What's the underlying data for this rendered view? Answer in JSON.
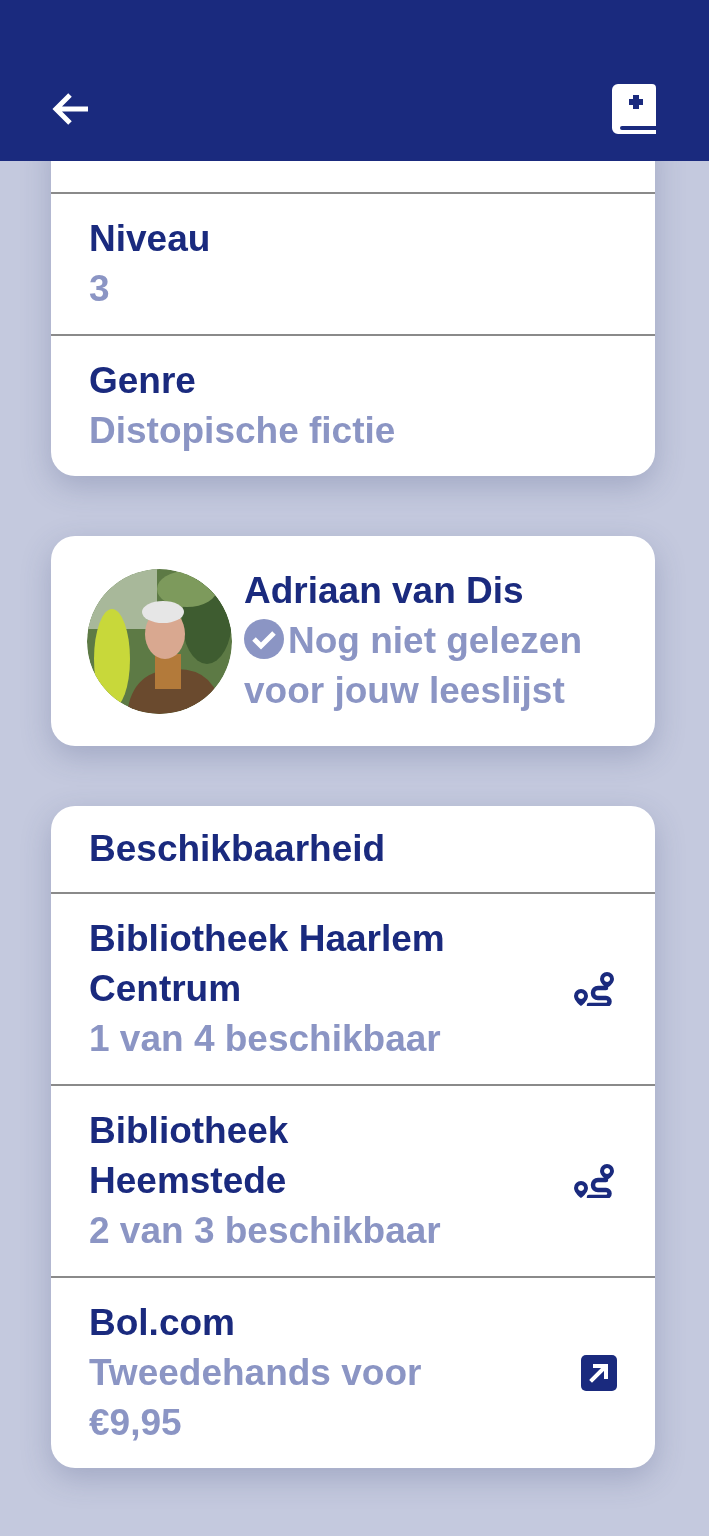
{
  "details": [
    {
      "label": "Niveau",
      "value": "3"
    },
    {
      "label": "Genre",
      "value": "Distopische fictie"
    }
  ],
  "author": {
    "name": "Adriaan van Dis",
    "status": "Nog niet gelezen voor jouw leeslijst"
  },
  "availability": {
    "title": "Beschikbaarheid",
    "items": [
      {
        "name": "Bibliotheek Haarlem Centrum",
        "detail": "1 van 4 beschikbaar",
        "kind": "route"
      },
      {
        "name": "Bibliotheek Heemstede",
        "detail": "2 van 3 beschikbaar",
        "kind": "route"
      },
      {
        "name": "Bol.com",
        "detail": "Tweedehands voor €9,95",
        "kind": "external"
      }
    ]
  }
}
